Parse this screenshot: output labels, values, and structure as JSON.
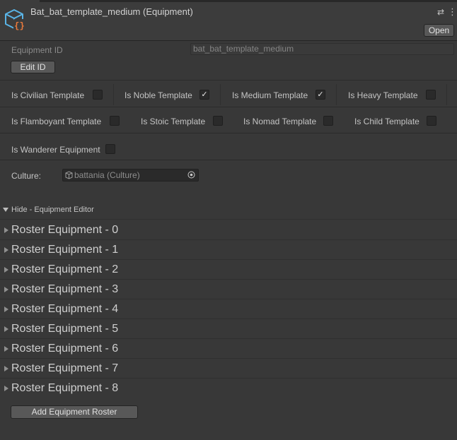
{
  "header": {
    "title": "Bat_bat_template_medium (Equipment)",
    "icon": "scriptable-object-icon",
    "settings_icon": "⇄",
    "more_icon": "⋮",
    "open_label": "Open"
  },
  "equipment_id": {
    "label": "Equipment ID",
    "value": "bat_bat_template_medium",
    "edit_label": "Edit ID"
  },
  "templates": [
    {
      "label": "Is Civilian Template",
      "checked": false
    },
    {
      "label": "Is Noble Template",
      "checked": true
    },
    {
      "label": "Is Medium Template",
      "checked": true
    },
    {
      "label": "Is Heavy Template",
      "checked": false
    },
    {
      "label": "Is Flamboyant Template",
      "checked": false
    },
    {
      "label": "Is Stoic Template",
      "checked": false
    },
    {
      "label": "Is Nomad Template",
      "checked": false
    },
    {
      "label": "Is Child Template",
      "checked": false
    },
    {
      "label": "Is Wanderer Equipment",
      "checked": false
    }
  ],
  "check_mark": "✓",
  "culture": {
    "label": "Culture:",
    "value": "battania (Culture)"
  },
  "editor": {
    "foldout_label": "Hide - Equipment Editor",
    "expanded": true
  },
  "rosters": [
    "Roster Equipment - 0",
    "Roster Equipment - 1",
    "Roster Equipment - 2",
    "Roster Equipment - 3",
    "Roster Equipment - 4",
    "Roster Equipment - 5",
    "Roster Equipment - 6",
    "Roster Equipment - 7",
    "Roster Equipment - 8"
  ],
  "add_roster_label": "Add Equipment Roster",
  "colors": {
    "background": "#383838",
    "icon_blue": "#5ab4e6",
    "icon_orange": "#ee7b3c"
  }
}
